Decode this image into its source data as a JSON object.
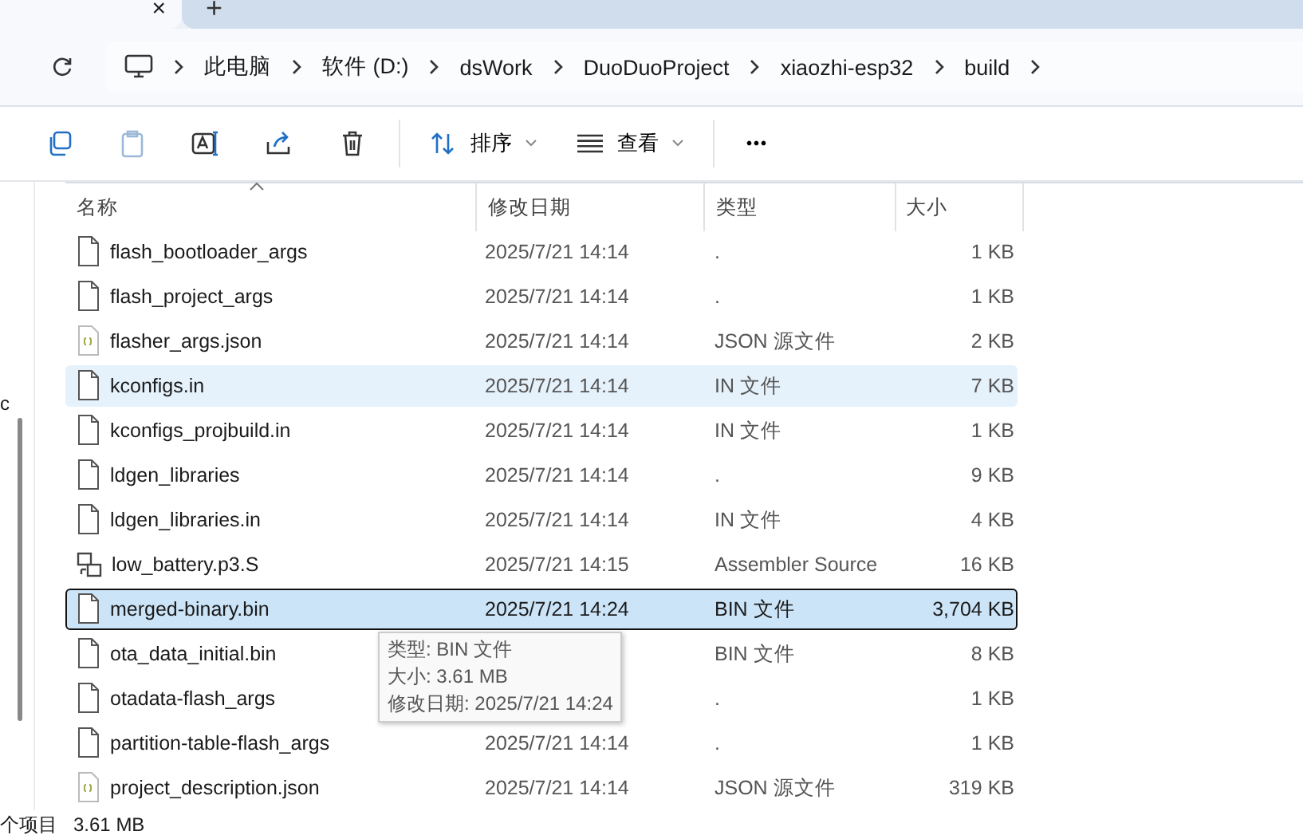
{
  "tab_strip": {
    "close_glyph": "×",
    "new_tab_glyph": "+"
  },
  "address_bar": {
    "crumbs": [
      "此电脑",
      "软件 (D:)",
      "dsWork",
      "DuoDuoProject",
      "xiaozhi-esp32",
      "build"
    ]
  },
  "toolbar": {
    "sort_label": "排序",
    "view_label": "查看",
    "more_glyph": "•••"
  },
  "nav_pane": {
    "cut_text": "c"
  },
  "table": {
    "columns": [
      "名称",
      "修改日期",
      "类型",
      "大小"
    ],
    "rows": [
      {
        "kind": "file",
        "name": "flash_bootloader_args",
        "date": "2025/7/21 14:14",
        "type": ".",
        "size": "1 KB",
        "hovered": false,
        "selected": false
      },
      {
        "kind": "file",
        "name": "flash_project_args",
        "date": "2025/7/21 14:14",
        "type": ".",
        "size": "1 KB",
        "hovered": false,
        "selected": false
      },
      {
        "kind": "json",
        "name": "flasher_args.json",
        "date": "2025/7/21 14:14",
        "type": "JSON 源文件",
        "size": "2 KB",
        "hovered": false,
        "selected": false
      },
      {
        "kind": "file",
        "name": "kconfigs.in",
        "date": "2025/7/21 14:14",
        "type": "IN 文件",
        "size": "7 KB",
        "hovered": true,
        "selected": false
      },
      {
        "kind": "file",
        "name": "kconfigs_projbuild.in",
        "date": "2025/7/21 14:14",
        "type": "IN 文件",
        "size": "1 KB",
        "hovered": false,
        "selected": false
      },
      {
        "kind": "file",
        "name": "ldgen_libraries",
        "date": "2025/7/21 14:14",
        "type": ".",
        "size": "9 KB",
        "hovered": false,
        "selected": false
      },
      {
        "kind": "file",
        "name": "ldgen_libraries.in",
        "date": "2025/7/21 14:14",
        "type": "IN 文件",
        "size": "4 KB",
        "hovered": false,
        "selected": false
      },
      {
        "kind": "asm",
        "name": "low_battery.p3.S",
        "date": "2025/7/21 14:15",
        "type": "Assembler Source",
        "size": "16 KB",
        "hovered": false,
        "selected": false
      },
      {
        "kind": "file",
        "name": "merged-binary.bin",
        "date": "2025/7/21 14:24",
        "type": "BIN 文件",
        "size": "3,704 KB",
        "hovered": false,
        "selected": true
      },
      {
        "kind": "file",
        "name": "ota_data_initial.bin",
        "type": "BIN 文件",
        "size": "8 KB",
        "hovered": false,
        "selected": false
      },
      {
        "kind": "file",
        "name": "otadata-flash_args",
        "type": ".",
        "size": "1 KB",
        "hovered": false,
        "selected": false
      },
      {
        "kind": "file",
        "name": "partition-table-flash_args",
        "date": "2025/7/21 14:14",
        "type": ".",
        "size": "1 KB",
        "hovered": false,
        "selected": false
      },
      {
        "kind": "json",
        "name": "project_description.json",
        "date": "2025/7/21 14:14",
        "type": "JSON 源文件",
        "size": "319 KB",
        "hovered": false,
        "selected": false
      }
    ]
  },
  "tooltip": {
    "lines": [
      "类型: BIN 文件",
      "大小: 3.61 MB",
      "修改日期: 2025/7/21 14:24"
    ]
  },
  "status_bar": {
    "count": "个项目",
    "selection_size": "3.61 MB"
  }
}
